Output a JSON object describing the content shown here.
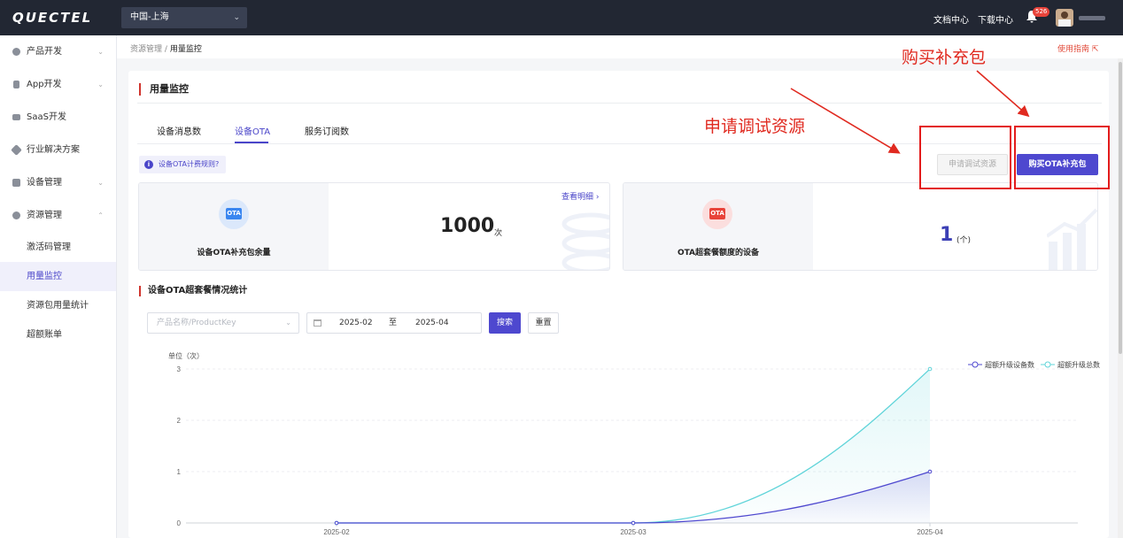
{
  "topbar": {
    "logo": "QUECTEL",
    "region": "中国-上海",
    "docs": "文档中心",
    "downloads": "下载中心",
    "notif_count": "526"
  },
  "sidebar": {
    "items": [
      {
        "label": "产品开发",
        "arrow": "⌄"
      },
      {
        "label": "App开发",
        "arrow": "⌄"
      },
      {
        "label": "SaaS开发",
        "arrow": ""
      },
      {
        "label": "行业解决方案",
        "arrow": ""
      },
      {
        "label": "设备管理",
        "arrow": "⌄"
      },
      {
        "label": "资源管理",
        "arrow": "⌃"
      }
    ],
    "subitems": [
      "激活码管理",
      "用量监控",
      "资源包用量统计",
      "超额账单"
    ]
  },
  "breadcrumb": {
    "parent": "资源管理",
    "sep": "/",
    "current": "用量监控",
    "guide": "使用指南 ⇱"
  },
  "page": {
    "title": "用量监控",
    "tabs": [
      "设备消息数",
      "设备OTA",
      "服务订阅数"
    ],
    "rule_link": "设备OTA计费规则?",
    "apply_btn": "申请调试资源",
    "buy_btn": "购买OTA补充包"
  },
  "annotations": {
    "buy": "购买补充包",
    "apply": "申请调试资源"
  },
  "stats": [
    {
      "icon": "OTA",
      "label": "设备OTA补充包余量",
      "value": "1000",
      "unit": "次",
      "more": "查看明细 ›"
    },
    {
      "icon": "OTA",
      "label": "OTA超套餐额度的设备",
      "value": "1",
      "unit": "(个)"
    }
  ],
  "section": {
    "title": "设备OTA超套餐情况统计"
  },
  "filters": {
    "product_placeholder": "产品名称/ProductKey",
    "start": "2025-02",
    "to": "至",
    "end": "2025-04",
    "search": "搜索",
    "reset": "重置"
  },
  "chart_data": {
    "type": "area",
    "ylabel": "单位（次）",
    "categories": [
      "2025-02",
      "2025-03",
      "2025-04"
    ],
    "ylim": [
      0,
      3
    ],
    "yticks": [
      "0",
      "1",
      "2",
      "3"
    ],
    "series": [
      {
        "name": "超额升级设备数",
        "values": [
          0,
          0,
          1
        ],
        "color": "#4e48cf"
      },
      {
        "name": "超额升级总数",
        "values": [
          0,
          0,
          3
        ],
        "color": "#5fd4d9"
      }
    ]
  }
}
